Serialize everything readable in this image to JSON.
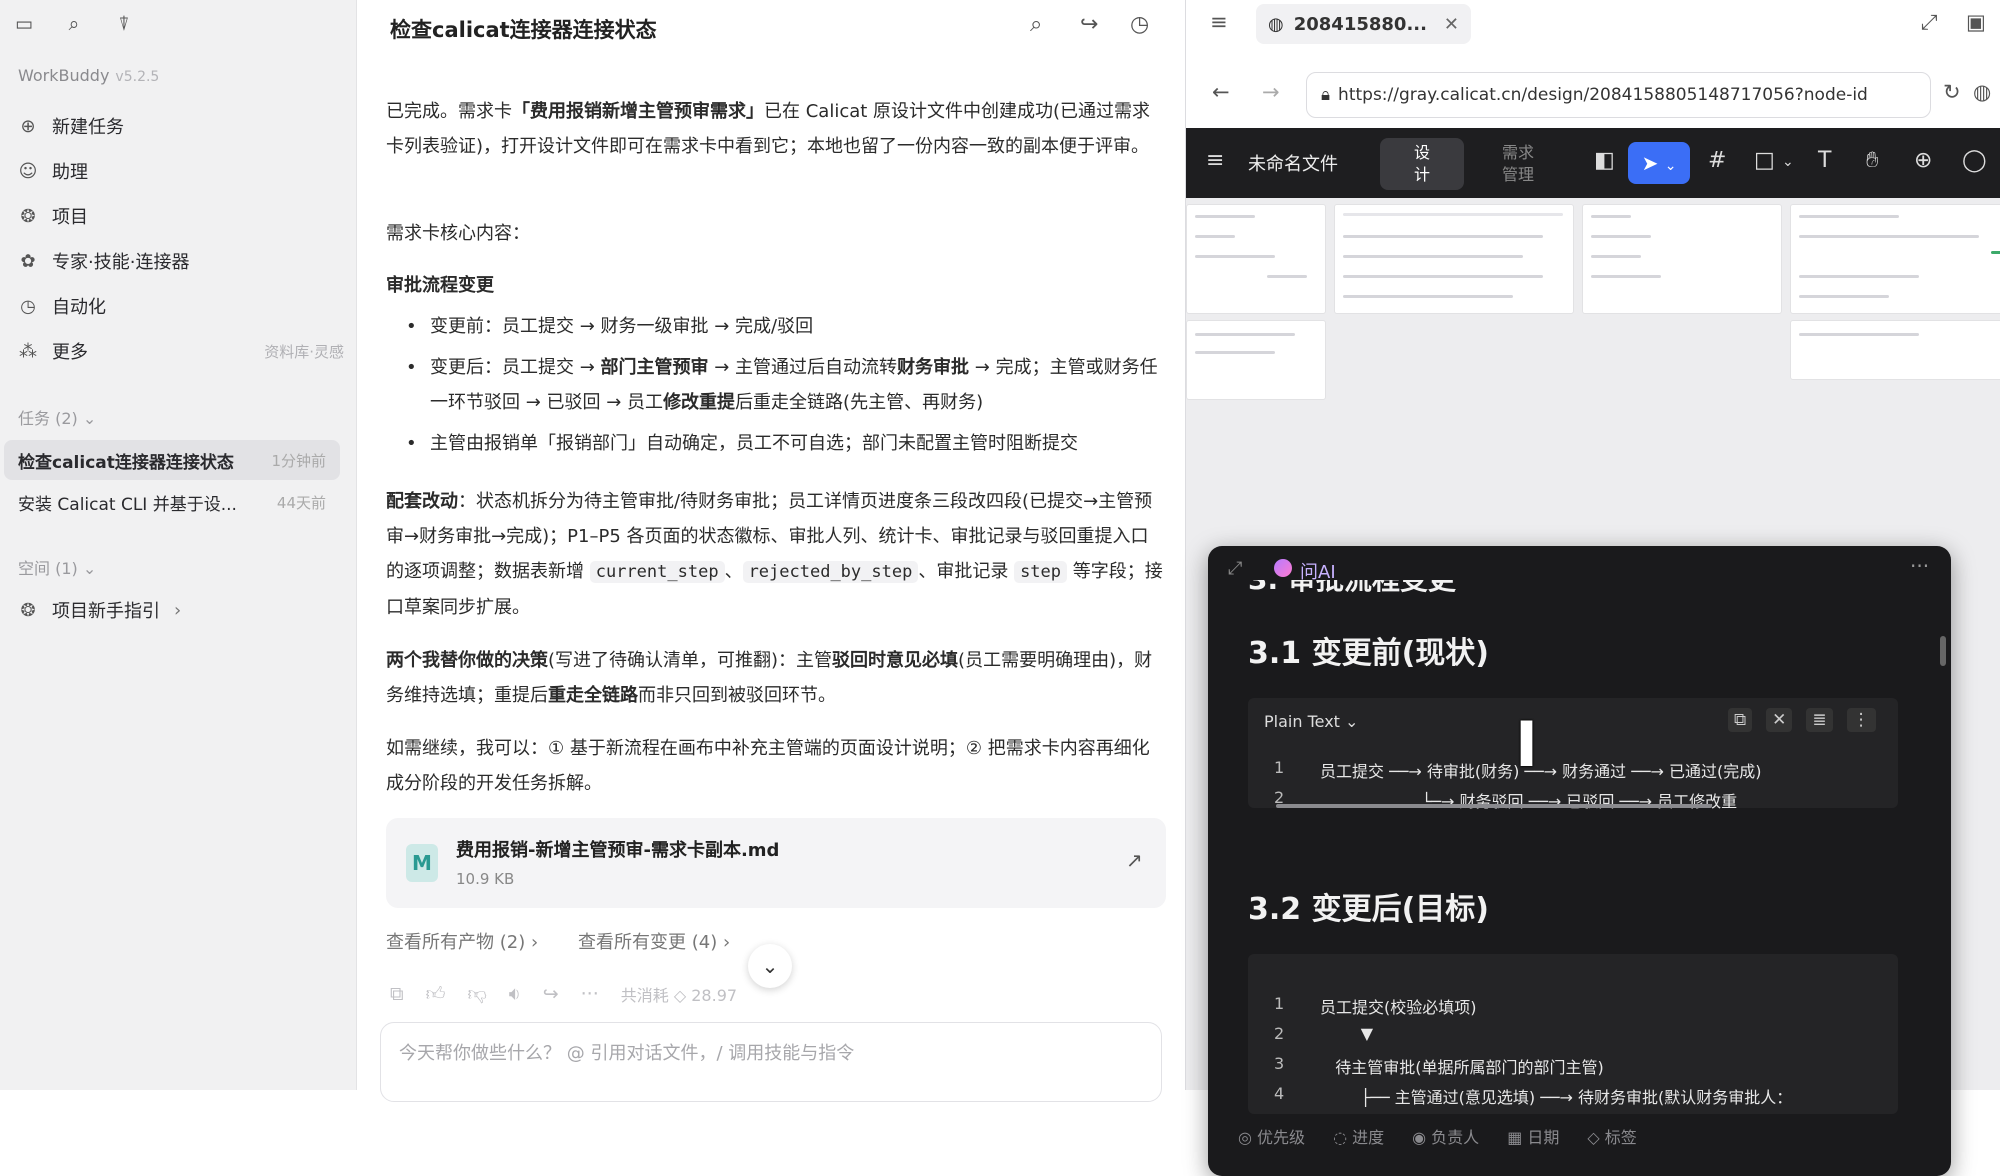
{
  "sidebar": {
    "brand": "WorkBuddy",
    "version": "v5.2.5",
    "nav": [
      {
        "label": "新建任务",
        "icon": "plus-circle-icon"
      },
      {
        "label": "助理",
        "icon": "person-icon"
      },
      {
        "label": "项目",
        "icon": "project-icon"
      },
      {
        "label": "专家·技能·连接器",
        "icon": "expert-icon"
      },
      {
        "label": "自动化",
        "icon": "clock-icon"
      },
      {
        "label": "更多",
        "icon": "more-icon",
        "extra": "资料库·灵感"
      }
    ],
    "tasks_header": "任务 (2)",
    "tasks": [
      {
        "title": "检查calicat连接器连接状态",
        "time": "1分钟前"
      },
      {
        "title": "安装 Calicat CLI 并基于设...",
        "time": "44天前"
      }
    ],
    "space_header": "空间 (1)",
    "space_item": "项目新手指引"
  },
  "chat": {
    "title": "检查calicat连接器连接状态",
    "p1_a": "已完成。需求卡",
    "p1_b": "「费用报销新增主管预审需求」",
    "p1_c": "已在 Calicat 原设计文件中创建成功(已通过需求卡列表验证)，打开设计文件即可在需求卡中看到它；本地也留了一份内容一致的副本便于评审。",
    "p2": "需求卡核心内容：",
    "h_flow": "审批流程变更",
    "b1": "变更前：员工提交 → 财务一级审批 → 完成/驳回",
    "b2_a": "变更后：员工提交 → ",
    "b2_b": "部门主管预审",
    "b2_c": " → 主管通过后自动流转",
    "b2_d": "财务审批",
    "b2_e": " → 完成；主管或财务任一环节驳回 → 已驳回 → 员工",
    "b2_f": "修改重提",
    "b2_g": "后重走全链路(先主管、再财务)",
    "b3": "主管由报销单「报销部门」自动确定，员工不可自选；部门未配置主管时阻断提交",
    "p3_a": "配套改动",
    "p3_b": "：状态机拆分为待主管审批/待财务审批；员工详情页进度条三段改四段(已提交→主管预审→财务审批→完成)；P1–P5 各页面的状态徽标、审批人列、统计卡、审批记录与驳回重提入口的逐项调整；数据表新增 ",
    "code1": "current_step",
    "sep1": "、",
    "code2": "rejected_by_step",
    "p3_c": "、审批记录 ",
    "code3": "step",
    "p3_d": " 等字段；接口草案同步扩展。",
    "p4_a": "两个我替你做的决策",
    "p4_b": "(写进了待确认清单，可推翻)：主管",
    "p4_c": "驳回时意见必填",
    "p4_d": "(员工需要明确理由)，财务维持选填；重提后",
    "p4_e": "重走全链路",
    "p4_f": "而非只回到被驳回环节。",
    "p5": "如需继续，我可以：① 基于新流程在画布中补充主管端的页面设计说明；② 把需求卡内容再细化成分阶段的开发任务拆解。",
    "file_name": "费用报销-新增主管预审-需求卡副本.md",
    "file_size": "10.9 KB",
    "link1": "查看所有产物 (2)",
    "link2": "查看所有变更 (4)",
    "usage": "共消耗 ◇ 28.97",
    "input_placeholder": "今天帮你做些什么？ @ 引用对话文件，/ 调用技能与指令"
  },
  "browser": {
    "tab_title": "208415880...",
    "url": "https://gray.calicat.cn/design/2084158805148717056?node-id",
    "file_name": "未命名文件",
    "mode_design": "设计",
    "mode_req": "需求管理",
    "ai": {
      "title": "问AI",
      "partial_heading": "3. 审批流程变更",
      "h31": "3.1 变更前(现状)",
      "lang": "Plain Text",
      "before_lines": [
        "员工提交 ──→ 待审批(财务) ──→ 财务通过 ──→ 已通过(完成)",
        "                    └─→ 财务驳回 ──→ 已驳回 ──→ 员工修改重"
      ],
      "h32": "3.2 变更后(目标)",
      "after_lines": [
        "员工提交(校验必填项)",
        "        ▼",
        "   待主管审批(单据所属部门的部门主管)",
        "        ├── 主管通过(意见选填) ──→ 待财务审批(默认财务审批人："
      ],
      "footer": [
        "优先级",
        "进度",
        "负责人",
        "日期",
        "标签"
      ]
    }
  }
}
